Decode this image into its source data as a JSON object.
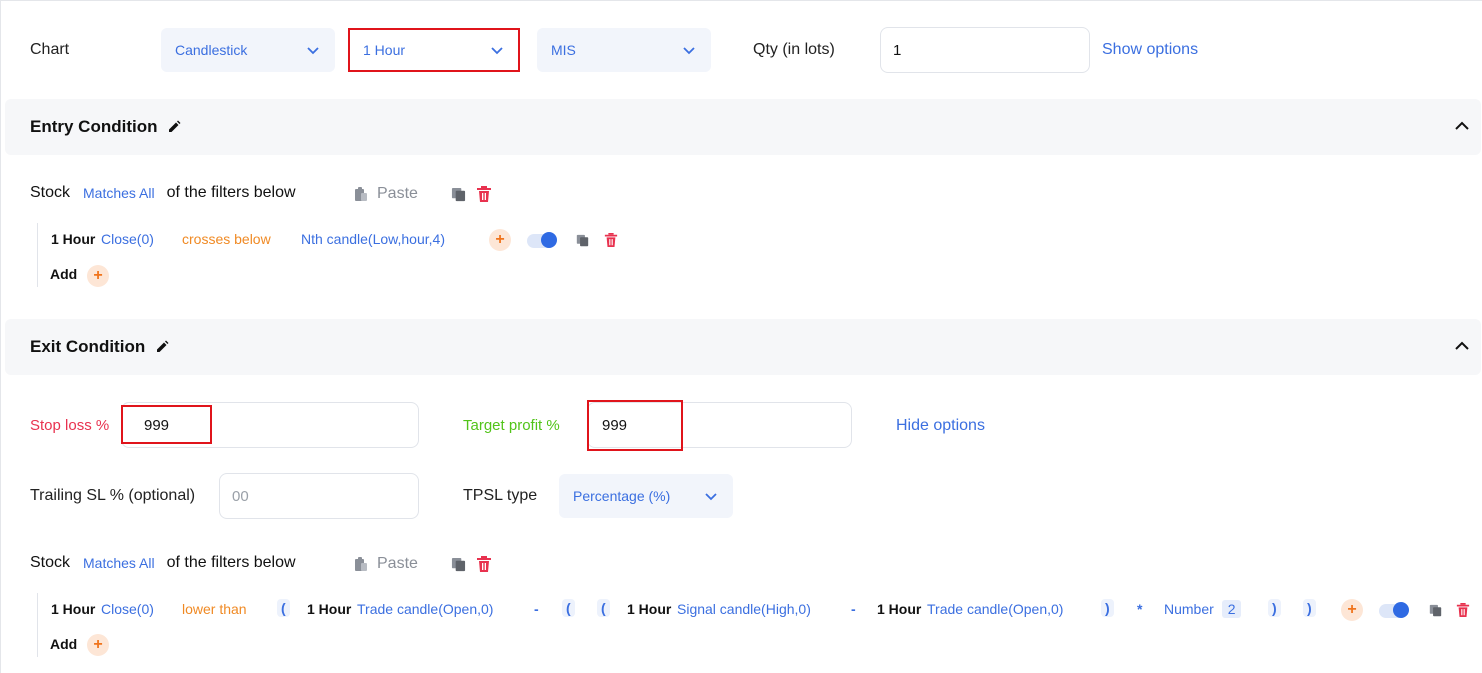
{
  "top": {
    "chart_label": "Chart",
    "chart_type": "Candlestick",
    "interval": "1 Hour",
    "product": "MIS",
    "qty_label": "Qty (in lots)",
    "qty_value": "1",
    "show_options": "Show options"
  },
  "entry": {
    "title": "Entry Condition",
    "stock_label": "Stock",
    "matches": "Matches All",
    "filters_text": "of the filters below",
    "paste": "Paste",
    "row": {
      "interval": "1 Hour",
      "left": "Close(0)",
      "operator": "crosses below",
      "right": "Nth candle(Low,hour,4)"
    },
    "add_label": "Add"
  },
  "exit": {
    "title": "Exit Condition",
    "stop_loss_label": "Stop loss %",
    "stop_loss_value": "999",
    "target_label": "Target profit %",
    "target_value": "999",
    "hide_options": "Hide options",
    "trailing_label": "Trailing SL % (optional)",
    "trailing_placeholder": "00",
    "tpsl_label": "TPSL type",
    "tpsl_value": "Percentage (%)",
    "stock_label": "Stock",
    "matches": "Matches All",
    "filters_text": "of the filters below",
    "paste": "Paste",
    "row": {
      "interval1": "1 Hour",
      "left": "Close(0)",
      "operator": "lower than",
      "paren_open": "(",
      "interval2": "1 Hour",
      "trade_open1": "Trade candle(Open,0)",
      "minus1": "-",
      "paren_open2": "(",
      "paren_open3": "(",
      "interval3": "1 Hour",
      "signal_high": "Signal candle(High,0)",
      "minus2": "-",
      "interval4": "1 Hour",
      "trade_open2": "Trade candle(Open,0)",
      "paren_close1": ")",
      "times": "*",
      "number_label": "Number",
      "number_value": "2",
      "paren_close2": ")",
      "paren_close3": ")"
    },
    "add_label": "Add"
  },
  "colors": {
    "accent_blue": "#3b6fe0",
    "orange": "#f08a24",
    "stop_loss_red": "#e8324f",
    "target_green": "#52c41a",
    "highlight_red": "#e0141b"
  },
  "icons": [
    "chevron-down-icon",
    "pencil-icon",
    "chevron-up-icon",
    "paste-icon",
    "copy-icon",
    "trash-icon",
    "plus-icon",
    "toggle-switch"
  ]
}
